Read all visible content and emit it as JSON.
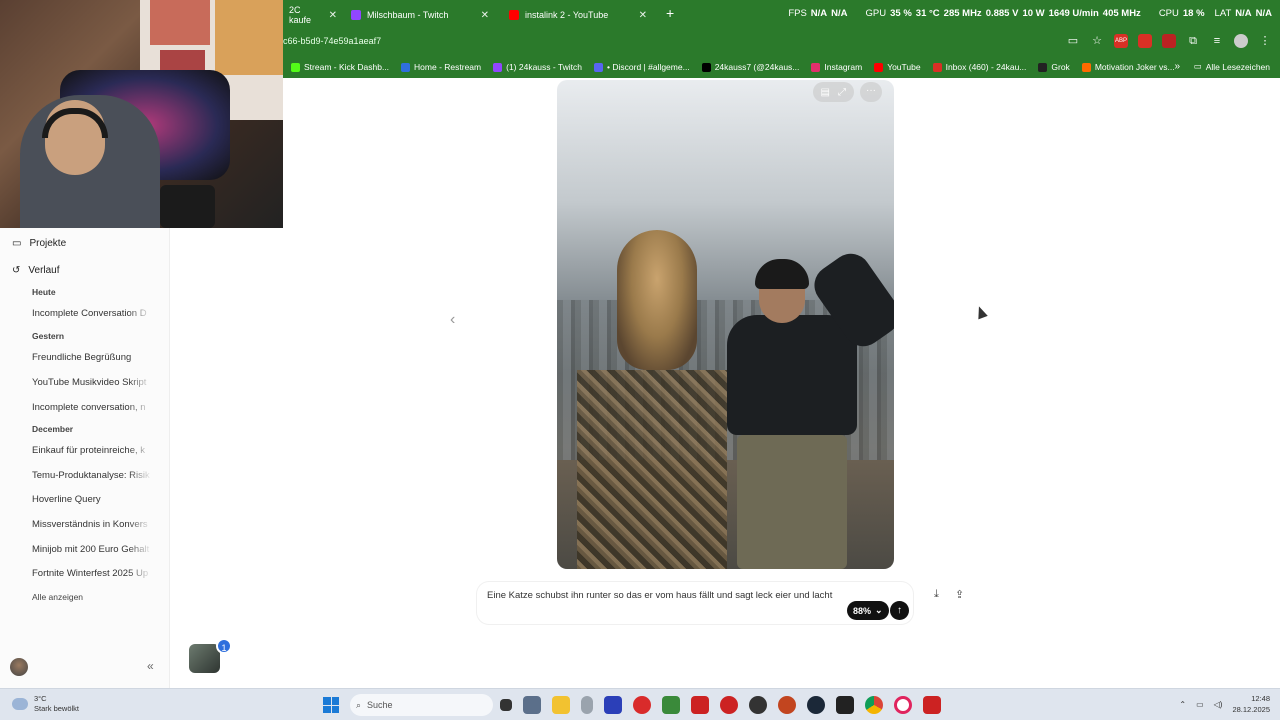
{
  "browser": {
    "tabs": [
      {
        "label": "2C kaufe",
        "color": "#2b7a2b"
      },
      {
        "label": "Milschbaum - Twitch",
        "color": "#9146ff"
      },
      {
        "label": "instalink 2 - YouTube",
        "color": "#ff0000"
      }
    ],
    "url": "c66-b5d9-74e59a1aeaf7",
    "hud": {
      "fps_label": "FPS",
      "fps_value": "N/A",
      "fps_value2": "N/A",
      "gpu_label": "GPU",
      "gpu_load": "35 %",
      "gpu_temp": "31 °C",
      "gpu_clock": "285 MHz",
      "gpu_volt": "0.885 V",
      "gpu_power": "10 W",
      "gpu_fan": "1649 U/min",
      "gpu_mem": "405 MHz",
      "cpu_label": "CPU",
      "cpu_load": "18 %",
      "lat_label": "LAT",
      "lat_value": "N/A",
      "lat_value2": "N/A"
    },
    "bookmarks": [
      {
        "label": "Stream - Kick Dashb...",
        "color": "#53fc18"
      },
      {
        "label": "Home - Restream",
        "color": "#2f6fdd"
      },
      {
        "label": "(1) 24kauss - Twitch",
        "color": "#9146ff"
      },
      {
        "label": "• Discord | #allgeme...",
        "color": "#5865f2"
      },
      {
        "label": "24kauss7 (@24kaus...",
        "color": "#000000"
      },
      {
        "label": "Instagram",
        "color": "#e1306c"
      },
      {
        "label": "YouTube",
        "color": "#ff0000"
      },
      {
        "label": "Inbox (460) - 24kau...",
        "color": "#d93025"
      },
      {
        "label": "Grok",
        "color": "#222222"
      },
      {
        "label": "Motivation Joker vs...",
        "color": "#ff6a00"
      }
    ],
    "bookmarks_all": "Alle Lesezeichen"
  },
  "sidebar": {
    "projects_label": "Projekte",
    "history_label": "Verlauf",
    "sections": [
      {
        "title": "Heute",
        "items": [
          "Incomplete Conversation D"
        ]
      },
      {
        "title": "Gestern",
        "items": [
          "Freundliche Begrüßung",
          "YouTube Musikvideo Skript",
          "Incomplete conversation, n"
        ]
      },
      {
        "title": "December",
        "items": [
          "Einkauf für proteinreiche, k",
          "Temu-Produktanalyse: Risik",
          "Hoverline Query",
          "Missverständnis in Konvers",
          "Minijob mit 200 Euro Gehalt",
          "Fortnite Winterfest 2025 Up"
        ]
      }
    ],
    "show_all": "Alle anzeigen"
  },
  "main": {
    "prompt_text": "Eine Katze schubst ihn runter so das er vom haus fällt und sagt leck eier und lacht",
    "percent": "88%",
    "thumb_badge": "1"
  },
  "taskbar": {
    "weather_temp": "3°C",
    "weather_desc": "Stark bewölkt",
    "search_placeholder": "Suche",
    "time": "12:48",
    "date": "28.12.2025"
  }
}
